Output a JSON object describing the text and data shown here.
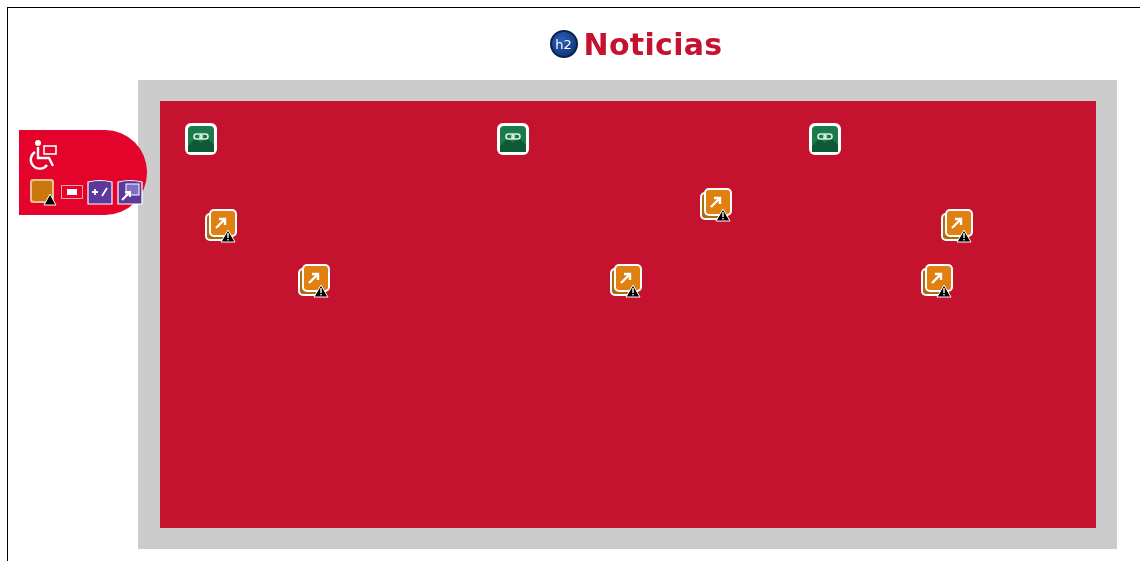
{
  "heading": {
    "badge": "h2",
    "title": "Noticias"
  },
  "columns": [
    {
      "markers": [
        {
          "kind": "link"
        },
        {
          "kind": "alert"
        },
        {
          "kind": "alert"
        }
      ]
    },
    {
      "markers": [
        {
          "kind": "link"
        },
        {
          "kind": "alert"
        },
        {
          "kind": "alert"
        }
      ]
    },
    {
      "markers": [
        {
          "kind": "link"
        },
        {
          "kind": "alert"
        },
        {
          "kind": "alert"
        }
      ]
    }
  ]
}
